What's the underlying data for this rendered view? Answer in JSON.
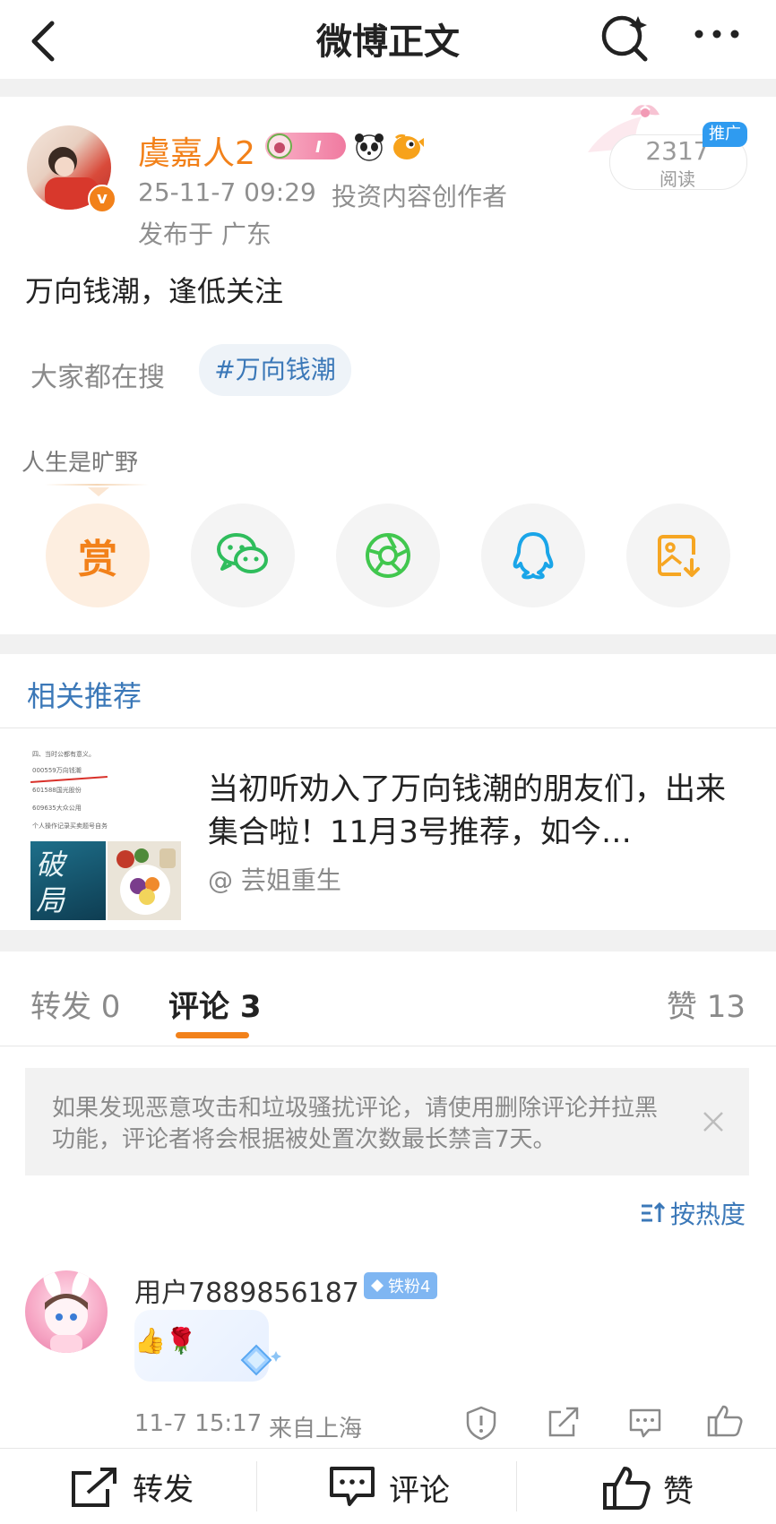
{
  "nav": {
    "title": "微博正文",
    "icons": [
      "back-chevron-icon",
      "search-icon",
      "more-icon"
    ]
  },
  "post": {
    "author": "虞嘉人2",
    "timestamp": "25-11-7 09:29",
    "author_tag": "投资内容创作者",
    "location": "发布于 广东",
    "read_count": "2317",
    "read_label": "阅读",
    "promo_badge": "推广",
    "content": "万向钱潮，逢低关注",
    "search_prompt": "大家都在搜",
    "topic_chip": "#万向钱潮",
    "signature": "人生是旷野",
    "reward_label": "赏"
  },
  "related": {
    "header": "相关推荐",
    "item": {
      "title": "当初听劝入了万向钱潮的朋友们，出来集合啦！11月3号推荐，如今…",
      "author": "@ 芸姐重生",
      "thumb_lines": [
        "四、当时公都有意义。",
        "000559万向钱潮",
        "601588国光股份",
        "609635大众公用",
        "个人操作记录买卖题号自务"
      ],
      "thumb_art_text": "破局"
    }
  },
  "tabs": [
    {
      "label": "转发 0"
    },
    {
      "label": "评论 3"
    },
    {
      "label": "赞 13"
    }
  ],
  "notice": {
    "text": "如果发现恶意攻击和垃圾骚扰评论，请使用删除评论并拉黑功能，评论者将会根据被处置次数最长禁言7天。"
  },
  "sort": {
    "label": "按热度"
  },
  "comment": {
    "user": "用户7889856187",
    "badge": "铁粉4",
    "emojis": "👍🌹",
    "time": "11-7 15:17",
    "location": "来自上海"
  },
  "bottom_bar": {
    "repost": "转发",
    "comment": "评论",
    "like": "赞"
  },
  "colors": {
    "accent_orange": "#f2811a",
    "link_blue": "#3b78b8",
    "wechat_green": "#2fbd5c",
    "moments_green": "#41c74e",
    "qq_blue": "#1aa5e8",
    "save_orange": "#f6a623"
  }
}
